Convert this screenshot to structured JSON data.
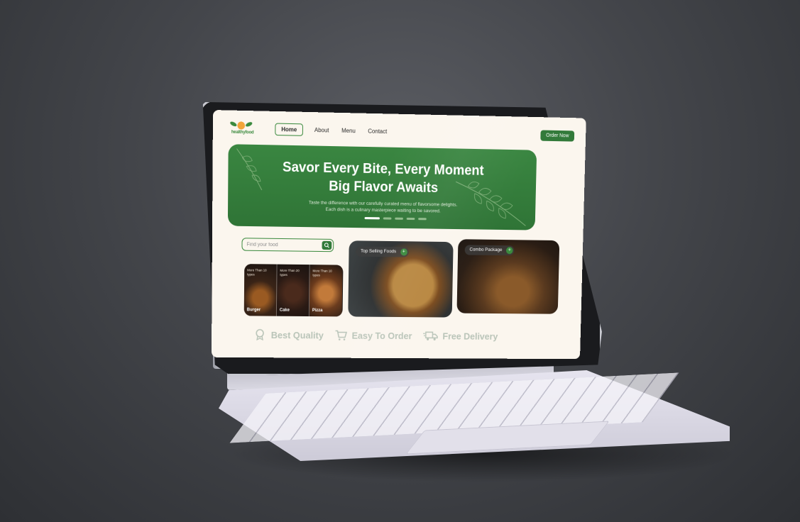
{
  "brand": {
    "logo_text": "healthyfood",
    "accent_color": "#327a3a",
    "background_color": "#fbf6ee"
  },
  "nav": {
    "items": [
      {
        "label": "Home",
        "active": true
      },
      {
        "label": "About",
        "active": false
      },
      {
        "label": "Menu",
        "active": false
      },
      {
        "label": "Contact",
        "active": false
      }
    ],
    "order_button": "Order Now"
  },
  "hero": {
    "title_line1": "Savor Every Bite, Every Moment",
    "title_line2": "Big Flavor Awaits",
    "subtitle_line1": "Taste the difference with our carefully curated menu of flavorsome delights.",
    "subtitle_line2": "Each dish is a culinary masterpiece waiting to be savored.",
    "slides": 5,
    "active_slide": 1
  },
  "search": {
    "placeholder": "Find your food",
    "icon": "search-icon"
  },
  "categories": [
    {
      "note": "More Than 10 types",
      "name": "Burger"
    },
    {
      "note": "More Than 20 types",
      "name": "Cake"
    },
    {
      "note": "More Than 10 types",
      "name": "Pizza"
    }
  ],
  "cards": {
    "top_selling": {
      "label": "Top Selling Foods",
      "icon": "plus-icon"
    },
    "combo": {
      "label": "Combo Package",
      "icon": "plus-icon"
    }
  },
  "features": [
    {
      "label": "Best Quality",
      "icon": "badge-icon"
    },
    {
      "label": "Easy To Order",
      "icon": "cart-icon"
    },
    {
      "label": "Free Delivery",
      "icon": "truck-icon"
    }
  ]
}
